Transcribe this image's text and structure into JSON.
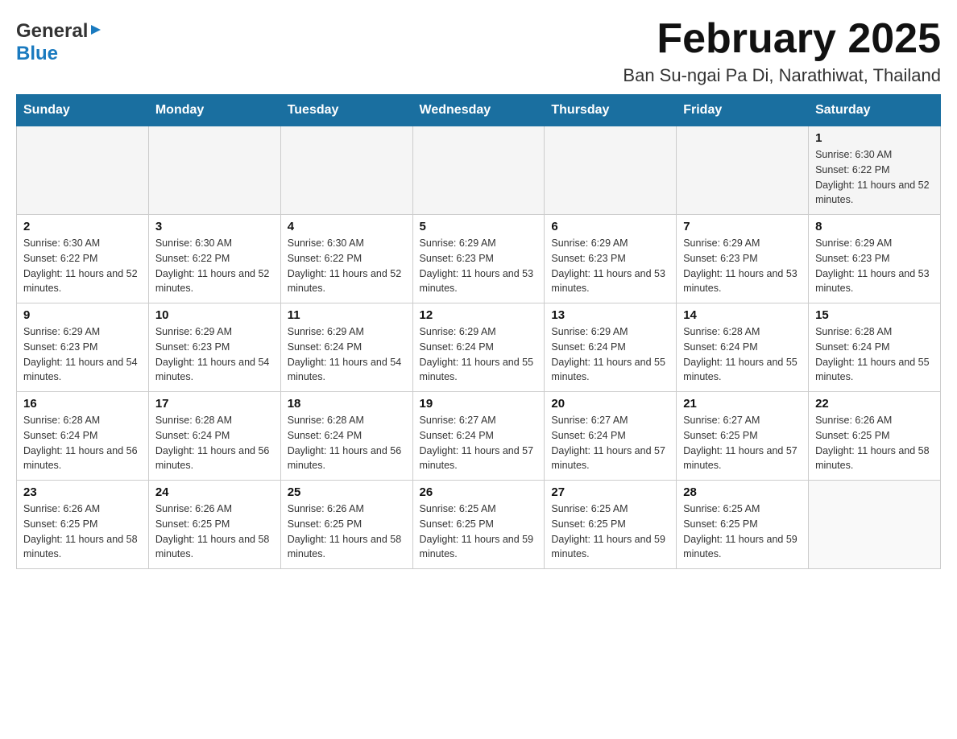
{
  "header": {
    "logo": {
      "general": "General",
      "blue": "Blue"
    },
    "title": "February 2025",
    "subtitle": "Ban Su-ngai Pa Di, Narathiwat, Thailand"
  },
  "calendar": {
    "days_of_week": [
      "Sunday",
      "Monday",
      "Tuesday",
      "Wednesday",
      "Thursday",
      "Friday",
      "Saturday"
    ],
    "weeks": [
      [
        {
          "day": "",
          "info": ""
        },
        {
          "day": "",
          "info": ""
        },
        {
          "day": "",
          "info": ""
        },
        {
          "day": "",
          "info": ""
        },
        {
          "day": "",
          "info": ""
        },
        {
          "day": "",
          "info": ""
        },
        {
          "day": "1",
          "info": "Sunrise: 6:30 AM\nSunset: 6:22 PM\nDaylight: 11 hours and 52 minutes."
        }
      ],
      [
        {
          "day": "2",
          "info": "Sunrise: 6:30 AM\nSunset: 6:22 PM\nDaylight: 11 hours and 52 minutes."
        },
        {
          "day": "3",
          "info": "Sunrise: 6:30 AM\nSunset: 6:22 PM\nDaylight: 11 hours and 52 minutes."
        },
        {
          "day": "4",
          "info": "Sunrise: 6:30 AM\nSunset: 6:22 PM\nDaylight: 11 hours and 52 minutes."
        },
        {
          "day": "5",
          "info": "Sunrise: 6:29 AM\nSunset: 6:23 PM\nDaylight: 11 hours and 53 minutes."
        },
        {
          "day": "6",
          "info": "Sunrise: 6:29 AM\nSunset: 6:23 PM\nDaylight: 11 hours and 53 minutes."
        },
        {
          "day": "7",
          "info": "Sunrise: 6:29 AM\nSunset: 6:23 PM\nDaylight: 11 hours and 53 minutes."
        },
        {
          "day": "8",
          "info": "Sunrise: 6:29 AM\nSunset: 6:23 PM\nDaylight: 11 hours and 53 minutes."
        }
      ],
      [
        {
          "day": "9",
          "info": "Sunrise: 6:29 AM\nSunset: 6:23 PM\nDaylight: 11 hours and 54 minutes."
        },
        {
          "day": "10",
          "info": "Sunrise: 6:29 AM\nSunset: 6:23 PM\nDaylight: 11 hours and 54 minutes."
        },
        {
          "day": "11",
          "info": "Sunrise: 6:29 AM\nSunset: 6:24 PM\nDaylight: 11 hours and 54 minutes."
        },
        {
          "day": "12",
          "info": "Sunrise: 6:29 AM\nSunset: 6:24 PM\nDaylight: 11 hours and 55 minutes."
        },
        {
          "day": "13",
          "info": "Sunrise: 6:29 AM\nSunset: 6:24 PM\nDaylight: 11 hours and 55 minutes."
        },
        {
          "day": "14",
          "info": "Sunrise: 6:28 AM\nSunset: 6:24 PM\nDaylight: 11 hours and 55 minutes."
        },
        {
          "day": "15",
          "info": "Sunrise: 6:28 AM\nSunset: 6:24 PM\nDaylight: 11 hours and 55 minutes."
        }
      ],
      [
        {
          "day": "16",
          "info": "Sunrise: 6:28 AM\nSunset: 6:24 PM\nDaylight: 11 hours and 56 minutes."
        },
        {
          "day": "17",
          "info": "Sunrise: 6:28 AM\nSunset: 6:24 PM\nDaylight: 11 hours and 56 minutes."
        },
        {
          "day": "18",
          "info": "Sunrise: 6:28 AM\nSunset: 6:24 PM\nDaylight: 11 hours and 56 minutes."
        },
        {
          "day": "19",
          "info": "Sunrise: 6:27 AM\nSunset: 6:24 PM\nDaylight: 11 hours and 57 minutes."
        },
        {
          "day": "20",
          "info": "Sunrise: 6:27 AM\nSunset: 6:24 PM\nDaylight: 11 hours and 57 minutes."
        },
        {
          "day": "21",
          "info": "Sunrise: 6:27 AM\nSunset: 6:25 PM\nDaylight: 11 hours and 57 minutes."
        },
        {
          "day": "22",
          "info": "Sunrise: 6:26 AM\nSunset: 6:25 PM\nDaylight: 11 hours and 58 minutes."
        }
      ],
      [
        {
          "day": "23",
          "info": "Sunrise: 6:26 AM\nSunset: 6:25 PM\nDaylight: 11 hours and 58 minutes."
        },
        {
          "day": "24",
          "info": "Sunrise: 6:26 AM\nSunset: 6:25 PM\nDaylight: 11 hours and 58 minutes."
        },
        {
          "day": "25",
          "info": "Sunrise: 6:26 AM\nSunset: 6:25 PM\nDaylight: 11 hours and 58 minutes."
        },
        {
          "day": "26",
          "info": "Sunrise: 6:25 AM\nSunset: 6:25 PM\nDaylight: 11 hours and 59 minutes."
        },
        {
          "day": "27",
          "info": "Sunrise: 6:25 AM\nSunset: 6:25 PM\nDaylight: 11 hours and 59 minutes."
        },
        {
          "day": "28",
          "info": "Sunrise: 6:25 AM\nSunset: 6:25 PM\nDaylight: 11 hours and 59 minutes."
        },
        {
          "day": "",
          "info": ""
        }
      ]
    ]
  }
}
